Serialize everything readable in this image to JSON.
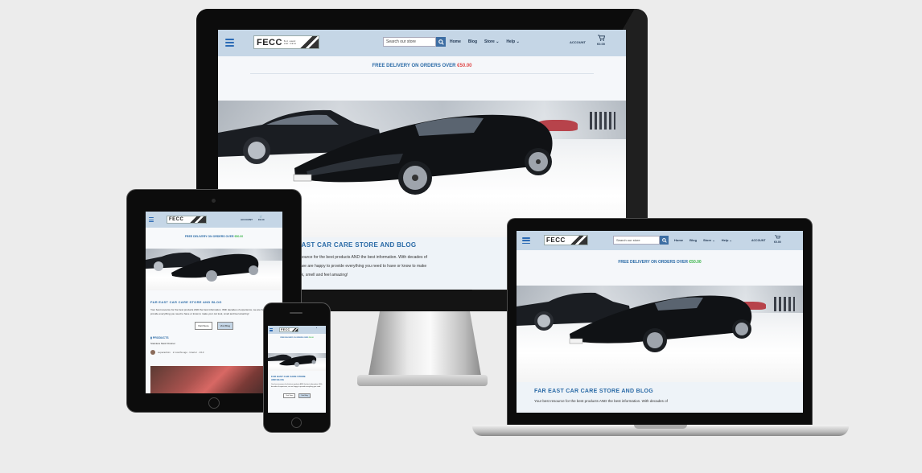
{
  "site": {
    "logo_text": "FECC",
    "logo_tag_1": "for east",
    "logo_tag_2": "car care",
    "search_placeholder": "Search our store",
    "nav_home": "Home",
    "nav_blog": "Blog",
    "nav_store": "Store",
    "nav_help": "Help",
    "account": "ACCOUNT",
    "cart_total": "€0.00",
    "banner_prefix": "FREE DELIVERY ON ORDERS OVER",
    "banner_price": "€50.00",
    "heading": "FAR EAST CAR CARE STORE AND BLOG",
    "desktop_heading_visible": "EAST CAR CARE STORE AND BLOG",
    "desktop_text_1": "resource for the best products AND the best information. With decades of",
    "desktop_text_2": "e, we are happy to provide everything you need to have or know to make",
    "desktop_text_3": "ook, smell and feel amazing!",
    "laptop_text_1": "Your best resource for the best products AND the best information. With decades of",
    "tablet_text": "Your best resource for the best products AND the best information. With decades of experience, we are happy to provide everything you need to have or know to make your car look, smell and feel amazing!",
    "visit_store": "Visit Store",
    "visit_blog": "Visit Blog",
    "products_label": "PRODUCTS",
    "product_name": "Stainless Mesh Drainer",
    "blog_author": "superadmin",
    "blog_meta": "2 months ago · Interior · 1/13",
    "phone_heading_1": "FAR EAST CAR CARE STORE",
    "phone_heading_2": "AND BLOG",
    "phone_text": "Your best resource for the best products AND the best information. With decades of experience, we are happy to provide everything you need."
  },
  "colors": {
    "nav_bg": "#c5d6e6",
    "accent": "#2a6aa6",
    "price_red": "#e04a4a",
    "price_green": "#3bb54a",
    "content_bg": "#eef3f8"
  },
  "icons": {
    "menu": "hamburger-icon",
    "search": "search-icon",
    "cart": "cart-icon",
    "chevron": "chevron-down-icon"
  }
}
